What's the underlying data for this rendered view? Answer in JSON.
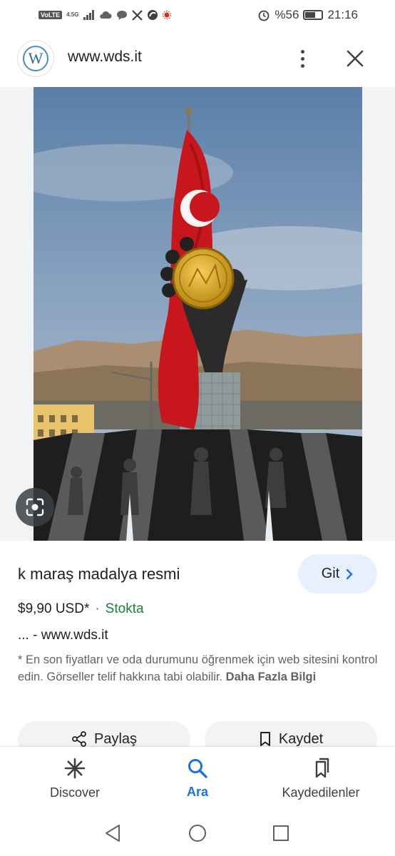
{
  "status_bar": {
    "volte": "VoLTE",
    "network": "4.5G",
    "alarm_icon": "alarm-icon",
    "battery_percent": "%56",
    "battery_level": 0.56,
    "time": "21:16"
  },
  "header": {
    "favicon_letter": "W",
    "url": "www.wds.it",
    "more_icon": "more-vert-icon",
    "close_icon": "close-icon"
  },
  "result": {
    "title": "k maraş madalya resmi",
    "visit_button": "Git",
    "price": "$9,90 USD*",
    "separator": "·",
    "stock": "Stokta",
    "source": "... - www.wds.it",
    "disclaimer": "* En son fiyatları ve oda durumunu öğrenmek için web sitesini kontrol edin. Görseller telif hakkına tabi olabilir.",
    "more_info": "Daha Fazla Bilgi",
    "share_label": "Paylaş",
    "save_label": "Kaydet"
  },
  "bottom_nav": {
    "discover": "Discover",
    "search": "Ara",
    "saved": "Kaydedilenler"
  },
  "colors": {
    "accent": "#1a73e8",
    "stock_green": "#188038",
    "pill_bg": "#e8f0fe"
  }
}
